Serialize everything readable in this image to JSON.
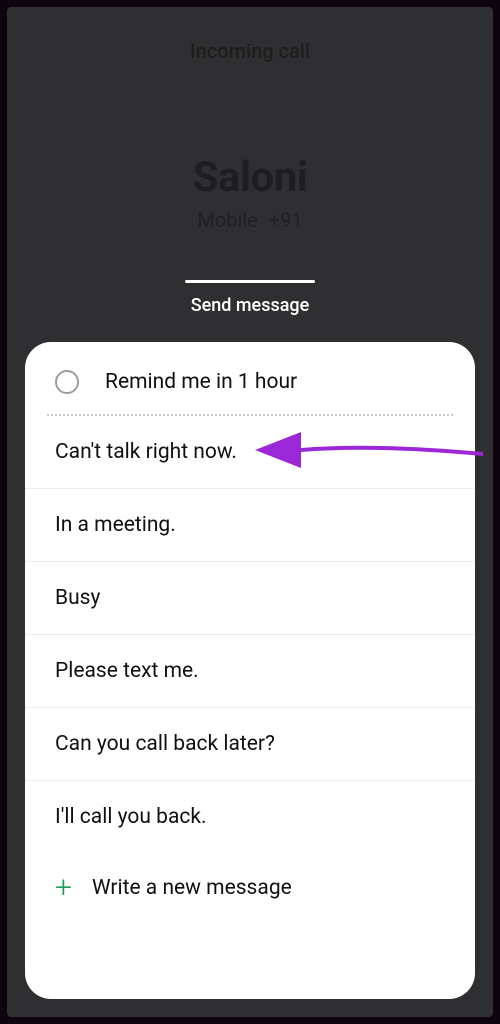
{
  "header": {
    "status": "Incoming call",
    "caller_name": "Saloni",
    "caller_type": "Mobile",
    "caller_number": "+91"
  },
  "send_message_label": "Send message",
  "remind": {
    "label": "Remind me in 1 hour"
  },
  "quick_replies": [
    "Can't talk right now.",
    "In a meeting.",
    "Busy",
    "Please text me.",
    "Can you call back later?",
    "I'll call you back."
  ],
  "new_message_label": "Write a new message",
  "annotation": {
    "color": "#9b27d6",
    "points_to_index": 0
  }
}
